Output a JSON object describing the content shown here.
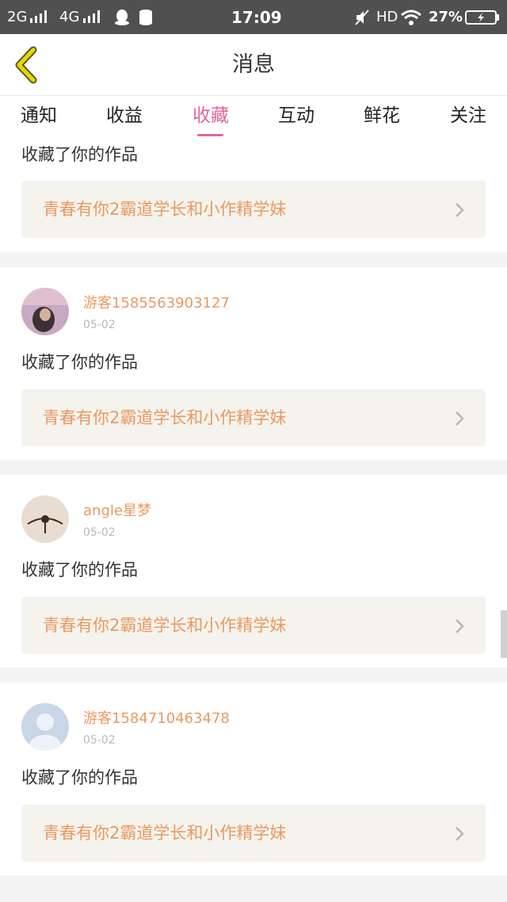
{
  "status_bar": {
    "left": "2G",
    "net": "4G",
    "time": "17:09",
    "hd": "HD",
    "battery": "27%"
  },
  "header": {
    "title": "消息"
  },
  "tabs": [
    {
      "label": "通知"
    },
    {
      "label": "收益"
    },
    {
      "label": "收藏",
      "active": true
    },
    {
      "label": "互动"
    },
    {
      "label": "鲜花"
    },
    {
      "label": "关注"
    }
  ],
  "items": [
    {
      "action": "收藏了你的作品",
      "work_title": "青春有你2霸道学长和小作精学妹"
    },
    {
      "user": "游客1585563903127",
      "date": "05-02",
      "action": "收藏了你的作品",
      "work_title": "青春有你2霸道学长和小作精学妹"
    },
    {
      "user": "angle星梦",
      "date": "05-02",
      "action": "收藏了你的作品",
      "work_title": "青春有你2霸道学长和小作精学妹"
    },
    {
      "user": "游客1584710463478",
      "date": "05-02",
      "action": "收藏了你的作品",
      "work_title": "青春有你2霸道学长和小作精学妹"
    }
  ],
  "colors": {
    "accent": "#e0659f",
    "username": "#ea9962",
    "work_box_bg": "#f4f3ed",
    "back_arrow": "#e6d800"
  },
  "icons": [
    "back-arrow-icon",
    "chevron-right-icon",
    "qq-icon",
    "mute-icon",
    "wifi-icon",
    "battery-icon"
  ]
}
